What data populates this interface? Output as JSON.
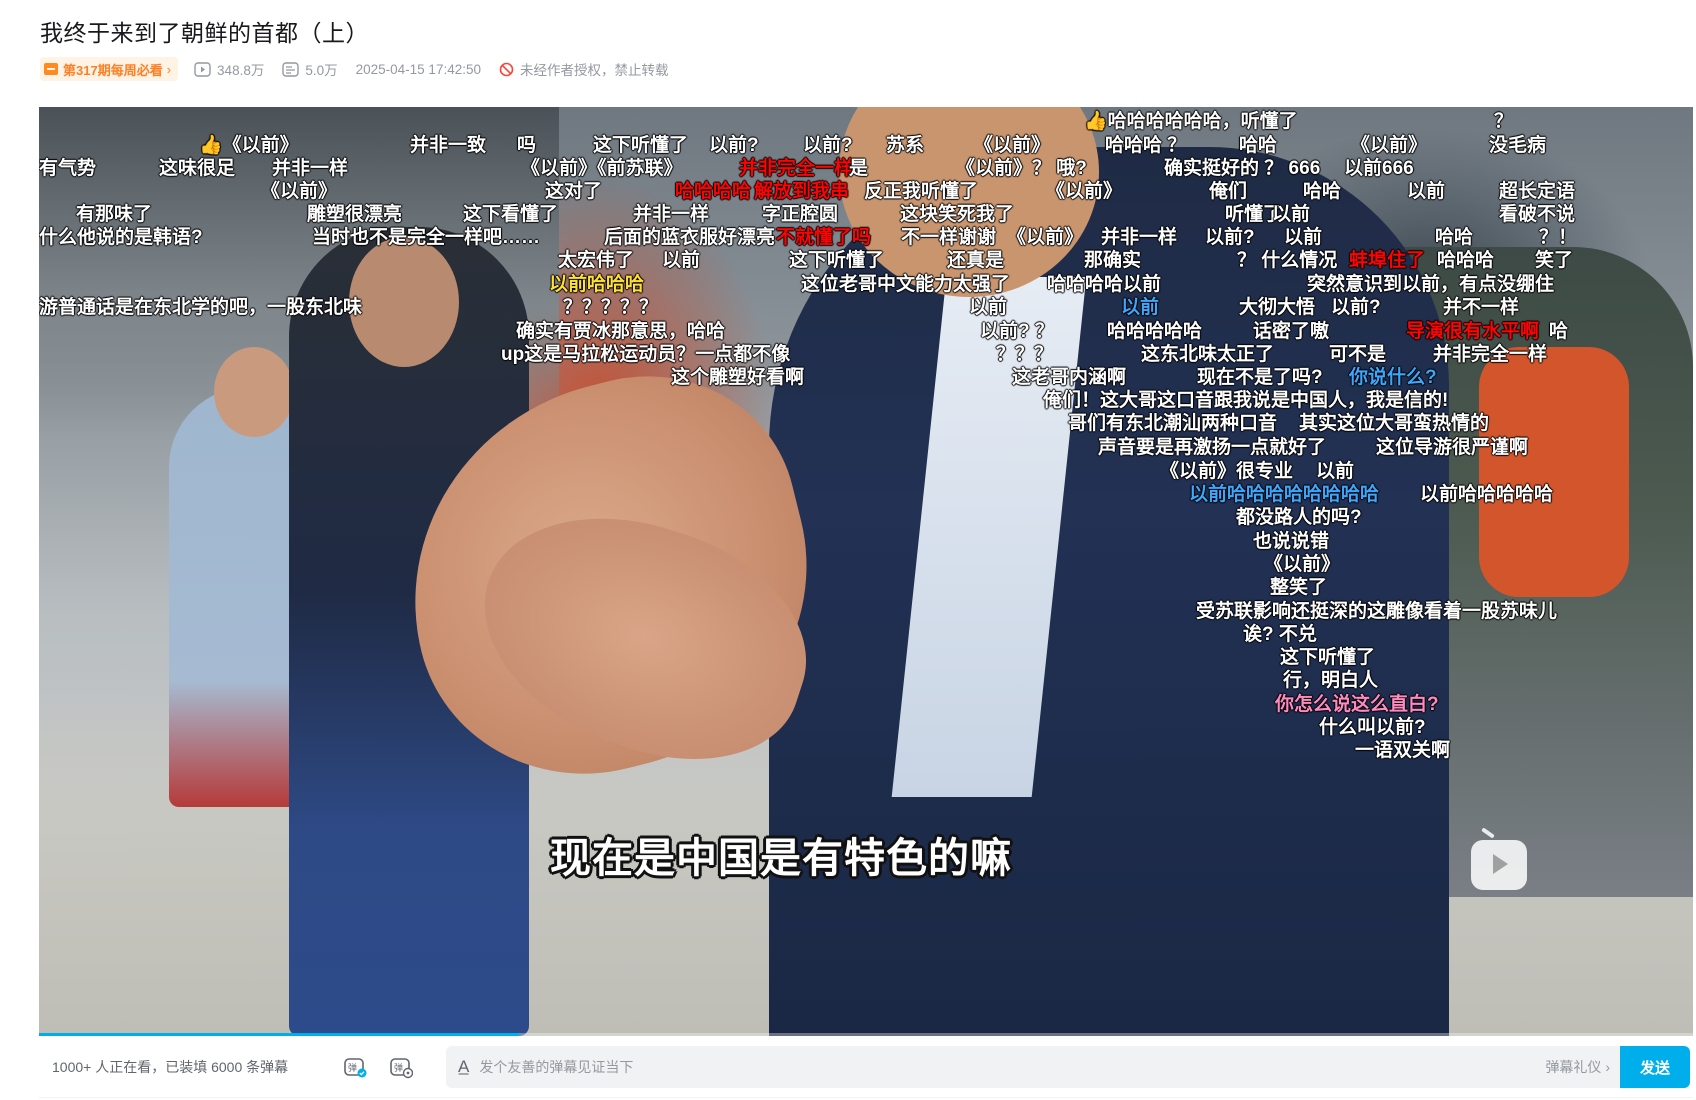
{
  "video": {
    "title": "我终于来到了朝鲜的首都（上）",
    "weekly_badge": "第317期每周必看",
    "views": "348.8万",
    "danmaku_count": "5.0万",
    "publish_time": "2025-04-15 17:42:50",
    "copyright_notice": "未经作者授权，禁止转载"
  },
  "player": {
    "subtitle": "现在是中国是有特色的嘛",
    "progress": 0.29,
    "danmaku": [
      {
        "text": "哈哈哈哈哈哈，听懂了",
        "thumb": true
      },
      {
        "text": "？"
      },
      {
        "text": "《以前》",
        "thumb": true
      },
      {
        "text": "并非一致"
      },
      {
        "text": "吗"
      },
      {
        "text": "这下听懂了"
      },
      {
        "text": "以前?"
      },
      {
        "text": "以前?"
      },
      {
        "text": "苏系"
      },
      {
        "text": "《以前》"
      },
      {
        "text": "哈哈哈 ？"
      },
      {
        "text": "哈哈"
      },
      {
        "text": "《以前》"
      },
      {
        "text": "没毛病"
      },
      {
        "text": "有气势"
      },
      {
        "text": "这味很足"
      },
      {
        "text": "并非一样"
      },
      {
        "text": "《以前》《前苏联》"
      },
      {
        "text": "并非完全一样",
        "color": "red"
      },
      {
        "text": "是"
      },
      {
        "text": "《以前》？ 哦?"
      },
      {
        "text": "确实挺好的 ？ 666"
      },
      {
        "text": "以前666"
      },
      {
        "text": "《以前》"
      },
      {
        "text": "这对了"
      },
      {
        "text": "哈哈哈哈",
        "color": "red"
      },
      {
        "text": "解放到我串",
        "color": "red"
      },
      {
        "text": "反正我听懂了"
      },
      {
        "text": "《以前》"
      },
      {
        "text": "俺们"
      },
      {
        "text": "哈哈"
      },
      {
        "text": "以前"
      },
      {
        "text": "超长定语"
      },
      {
        "text": "有那味了"
      },
      {
        "text": "雕塑很漂亮"
      },
      {
        "text": "这下看懂了"
      },
      {
        "text": "并非一样"
      },
      {
        "text": "字正腔圆"
      },
      {
        "text": "这块笑死我了"
      },
      {
        "text": "听懂了"
      },
      {
        "text": "以前"
      },
      {
        "text": "看破不说"
      },
      {
        "text": "什么他说的是韩语?"
      },
      {
        "text": "当时也不是完全一样吧……"
      },
      {
        "text": "后面的蓝衣服好漂亮"
      },
      {
        "text": "不就懂了吗",
        "color": "red"
      },
      {
        "text": "不一样谢谢"
      },
      {
        "text": "《以前》"
      },
      {
        "text": "并非一样"
      },
      {
        "text": "以前?"
      },
      {
        "text": "以前"
      },
      {
        "text": "哈哈"
      },
      {
        "text": "？！"
      },
      {
        "text": "太宏伟了"
      },
      {
        "text": "以前"
      },
      {
        "text": "这下听懂了"
      },
      {
        "text": "还真是"
      },
      {
        "text": "那确实"
      },
      {
        "text": "？ 什么情况"
      },
      {
        "text": "蚌埠住了",
        "color": "red"
      },
      {
        "text": "哈哈哈"
      },
      {
        "text": "笑了"
      },
      {
        "text": "以前哈哈哈",
        "color": "yel"
      },
      {
        "text": "这位老哥中文能力太强了"
      },
      {
        "text": "哈哈哈哈以前"
      },
      {
        "text": "突然意识到以前，有点没绷住"
      },
      {
        "text": "游普通话是在东北学的吧，一股东北味"
      },
      {
        "text": "？？？？？"
      },
      {
        "text": "以前"
      },
      {
        "text": "以前",
        "color": "blue"
      },
      {
        "text": "大彻大悟"
      },
      {
        "text": "以前?"
      },
      {
        "text": "并不一样"
      },
      {
        "text": "确实有贾冰那意思，哈哈"
      },
      {
        "text": "以前? ？"
      },
      {
        "text": "哈哈哈哈哈"
      },
      {
        "text": "话密了嗷"
      },
      {
        "text": "导演很有水平啊",
        "color": "red"
      },
      {
        "text": "哈"
      },
      {
        "text": "up这是马拉松运动员？一点都不像"
      },
      {
        "text": "？？？"
      },
      {
        "text": "这东北味太正了"
      },
      {
        "text": "可不是"
      },
      {
        "text": "并非完全一样"
      },
      {
        "text": "这个雕塑好看啊"
      },
      {
        "text": "这老哥内涵啊"
      },
      {
        "text": "现在不是了吗?"
      },
      {
        "text": "你说什么?",
        "color": "blue"
      },
      {
        "text": "俺们！这大哥这口音跟我说是中国人，我是信的!"
      },
      {
        "text": "哥们有东北潮汕两种口音"
      },
      {
        "text": "其实这位大哥蛮热情的"
      },
      {
        "text": "声音要是再激扬一点就好了"
      },
      {
        "text": "这位导游很严谨啊"
      },
      {
        "text": "《以前》很专业"
      },
      {
        "text": "以前"
      },
      {
        "text": "以前哈哈哈哈哈哈哈哈",
        "color": "blue"
      },
      {
        "text": "以前哈哈哈哈哈"
      },
      {
        "text": "都没路人的吗?"
      },
      {
        "text": "也说说错"
      },
      {
        "text": "《以前》"
      },
      {
        "text": "整笑了"
      },
      {
        "text": "受苏联影响还挺深的这雕像看着一股苏味儿"
      },
      {
        "text": "诶? 不兑"
      },
      {
        "text": "这下听懂了"
      },
      {
        "text": "行，明白人"
      },
      {
        "text": "你怎么说这么直白?",
        "color": "pink"
      },
      {
        "text": "什么叫以前?"
      },
      {
        "text": "一语双关啊"
      }
    ]
  },
  "sendbar": {
    "watching_text": "1000+ 人正在看，已装填 6000 条弹幕",
    "input_placeholder": "发个友善的弹幕见证当下",
    "etiquette_label": "弹幕礼仪 ›",
    "send_label": "发送"
  }
}
